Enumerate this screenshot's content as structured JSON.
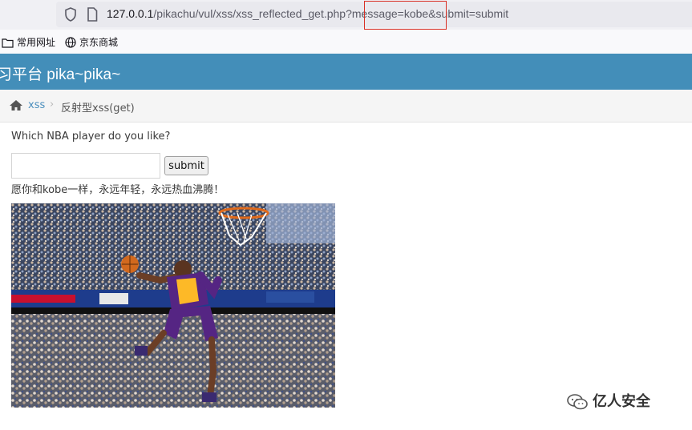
{
  "browser": {
    "url_host": "127.0.0.1",
    "url_path": "/pikachu/vul/xss/xss_reflected_get.php?message=kobe&submit=submit",
    "icons": [
      "shield-icon",
      "page-icon"
    ]
  },
  "bookmarks": [
    {
      "label": "常用网址",
      "icon": "folder-icon"
    },
    {
      "label": "京东商城",
      "icon": "globe-icon"
    }
  ],
  "header": {
    "title": "习平台 pika~pika~"
  },
  "breadcrumb": {
    "link": "xss",
    "separator": "›",
    "current": "反射型xss(get)"
  },
  "form": {
    "question": "Which NBA player do you like?",
    "input_value": "",
    "submit_label": "submit",
    "result": "愿你和kobe一样，永远年轻，永远热血沸腾！"
  },
  "watermark": {
    "text": "亿人安全"
  },
  "colors": {
    "header": "#438eb9",
    "highlight": "#d93025",
    "link": "#4c8fbd"
  }
}
